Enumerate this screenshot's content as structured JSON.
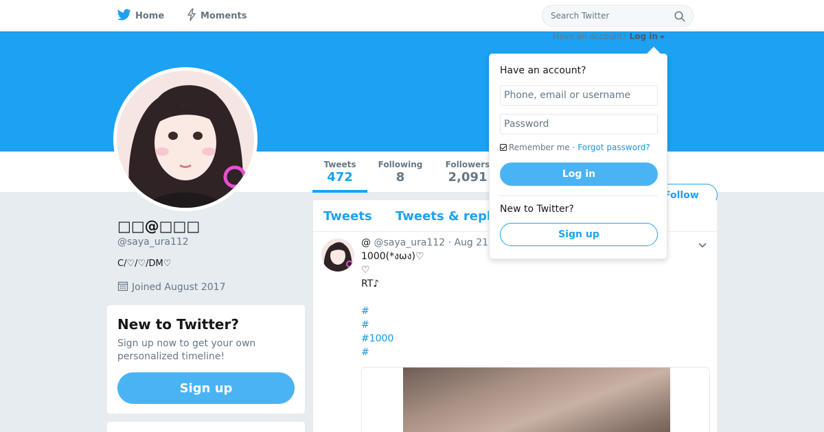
{
  "nav": {
    "home_label": "Home",
    "moments_label": "Moments",
    "search_placeholder": "Search Twitter"
  },
  "login_hint": {
    "text": "Have an account?",
    "link": "Log in"
  },
  "profile": {
    "name": "□□@□□□",
    "handle": "@saya_ura112",
    "bio": "C/♡/♡/DM♡",
    "joined": "Joined August 2017"
  },
  "stats": [
    {
      "label": "Tweets",
      "value": "472"
    },
    {
      "label": "Following",
      "value": "8"
    },
    {
      "label": "Followers",
      "value": "2,091"
    }
  ],
  "follow_label": "Follow",
  "new_card": {
    "title": "New to Twitter?",
    "text": "Sign up now to get your own personalized timeline!",
    "button": "Sign up"
  },
  "timeline_tabs": [
    "Tweets",
    "Tweets & repl"
  ],
  "tweet": {
    "name": "@",
    "handle": "@saya_ura112",
    "date": "· Aug 21",
    "lines": [
      "1000(*งωง)♡",
      "♡",
      "RT♪",
      "",
      "#",
      "#",
      "#1000",
      "#"
    ]
  },
  "login_dropdown": {
    "title": "Have an account?",
    "username_placeholder": "Phone, email or username",
    "password_placeholder": "Password",
    "remember": "Remember me",
    "forgot": "· Forgot password?",
    "login_button": "Log in",
    "new_title": "New to Twitter?",
    "signup_button": "Sign up"
  },
  "colors": {
    "brand": "#1da1f2",
    "button": "#4ab3f4",
    "background": "#e6ecf0"
  }
}
